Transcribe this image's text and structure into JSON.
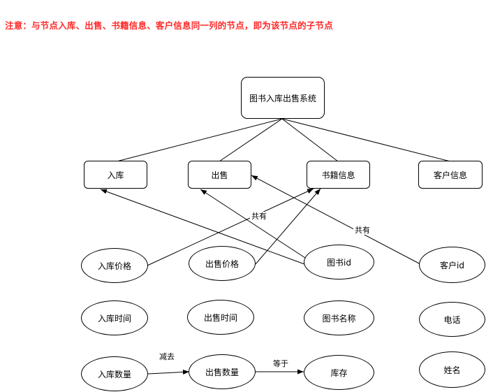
{
  "note": "注意：与节点入库、出售、书籍信息、客户信息同一列的节点，即为该节点的子节点",
  "root": "图书入库出售系统",
  "children": [
    "入库",
    "出售",
    "书籍信息",
    "客户信息"
  ],
  "attributes": {
    "col1": [
      "入库价格",
      "入库时间",
      "入库数量"
    ],
    "col2": [
      "出售价格",
      "出售时间",
      "出售数量"
    ],
    "col3": [
      "图书id",
      "图书名称",
      "库存"
    ],
    "col4": [
      "客户id",
      "电话",
      "姓名"
    ]
  },
  "edge_labels": {
    "shared_1": "共有",
    "shared_2": "共有",
    "subtract": "减去",
    "equals": "等于"
  }
}
